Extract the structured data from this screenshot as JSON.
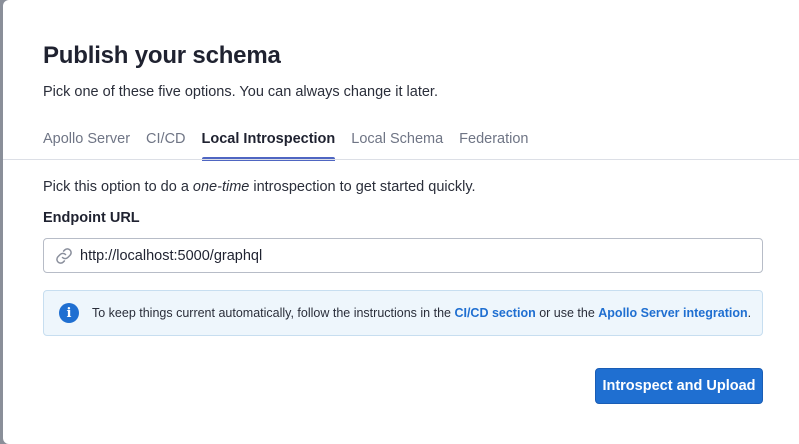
{
  "dialog": {
    "title": "Publish your schema",
    "subtitle": "Pick one of these five options. You can always change it later."
  },
  "tabs": [
    {
      "label": "Apollo Server",
      "active": false
    },
    {
      "label": "CI/CD",
      "active": false
    },
    {
      "label": "Local Introspection",
      "active": true
    },
    {
      "label": "Local Schema",
      "active": false
    },
    {
      "label": "Federation",
      "active": false
    }
  ],
  "content": {
    "description_before": "Pick this option to do a ",
    "description_emphasis": "one-time",
    "description_after": " introspection to get started quickly.",
    "endpoint_label": "Endpoint URL",
    "endpoint_value": "http://localhost:5000/graphql",
    "endpoint_icon": "link-icon"
  },
  "info": {
    "icon": "info-icon",
    "text_before": "To keep things current automatically, follow the instructions in the ",
    "link1": "CI/CD section",
    "text_middle": " or use the ",
    "link2": "Apollo Server integration",
    "text_after": "."
  },
  "actions": {
    "primary_label": "Introspect and Upload"
  },
  "colors": {
    "accent": "#1f6fd1",
    "tab_indicator": "#4f66c2",
    "info_bg": "#eef6fc"
  }
}
